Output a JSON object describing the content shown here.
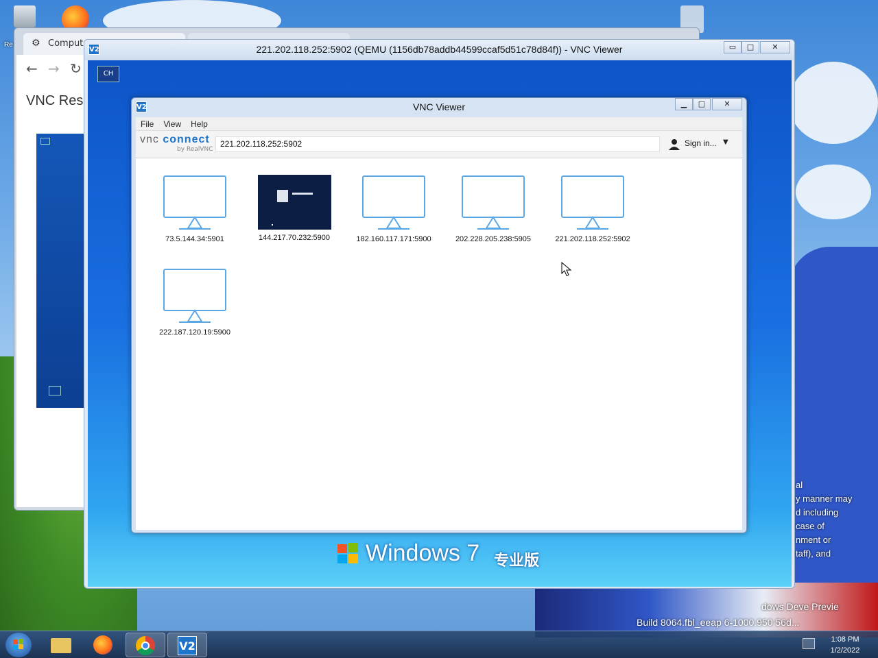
{
  "browser": {
    "tab_label": "Compute",
    "page_heading": "VNC Reso",
    "left_edge_text": "Re"
  },
  "remote_window": {
    "title": "221.202.118.252:5902 (QEMU (1156db78addb44599ccaf5d51c78d84f)) - VNC Viewer",
    "input_indicator": "CH",
    "os_brand": "Windows 7",
    "os_edition": "专业版",
    "minimize": "▭",
    "maximize": "□",
    "close": "✕"
  },
  "viewer": {
    "title": "VNC Viewer",
    "menu": [
      "File",
      "View",
      "Help"
    ],
    "logo_vnc": "vnc",
    "logo_connect": "connect",
    "logo_sub": "by RealVNC",
    "address_value": "221.202.118.252:5902",
    "sign_in_label": "Sign in...",
    "connections": [
      {
        "label": "73.5.144.34:5901",
        "thumbnail": "monitor-icon"
      },
      {
        "label": "144.217.70.232:5900",
        "thumbnail": "screenshot"
      },
      {
        "label": "182.160.117.171:5900",
        "thumbnail": "monitor-icon"
      },
      {
        "label": "202.228.205.238:5905",
        "thumbnail": "monitor-icon"
      },
      {
        "label": "221.202.118.252:5902",
        "thumbnail": "monitor-icon"
      },
      {
        "label": "222.187.120.19:5900",
        "thumbnail": "monitor-icon"
      }
    ]
  },
  "desktop": {
    "overlay_lines": [
      "al",
      "y manner may",
      "d including",
      "case of",
      "nment or",
      "taff), and"
    ],
    "watermark_line1": "dows Deve        Previe",
    "watermark_line2": "Build 8064.fbl_eeap      6-1000.950   56d..."
  },
  "taskbar": {
    "items": [
      "start-button",
      "file-explorer",
      "firefox",
      "chrome",
      "vnc-viewer"
    ],
    "time": "1:08 PM",
    "date": "1/2/2022"
  },
  "colors": {
    "accent": "#1f74c9",
    "monitor_outline": "#5aa7e6",
    "remote_desktop": "#1a6fe0"
  }
}
